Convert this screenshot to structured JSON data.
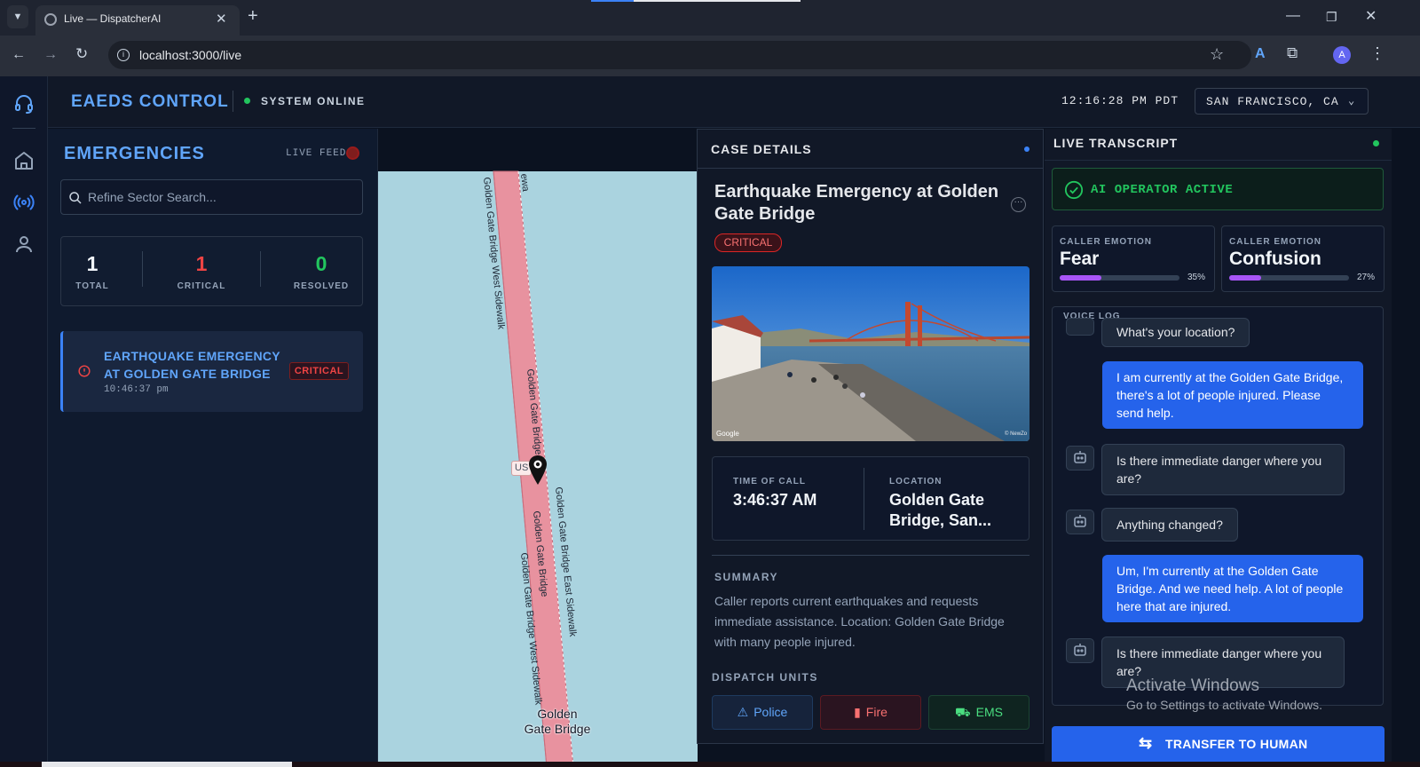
{
  "browser": {
    "tab_title": "Live — DispatcherAI",
    "url": "localhost:3000/live",
    "profile_initial": "A"
  },
  "header": {
    "brand": "EAEDS CONTROL",
    "status": "SYSTEM ONLINE",
    "clock": "12:16:28 PM PDT",
    "region": "SAN FRANCISCO, CA"
  },
  "emergencies": {
    "title": "EMERGENCIES",
    "live_feed": "LIVE FEED",
    "search_placeholder": "Refine Sector Search...",
    "stats": [
      {
        "value": "1",
        "label": "TOTAL",
        "color": "#f1f5f9"
      },
      {
        "value": "1",
        "label": "CRITICAL",
        "color": "#ef4444"
      },
      {
        "value": "0",
        "label": "RESOLVED",
        "color": "#22c55e"
      }
    ],
    "items": [
      {
        "title": "EARTHQUAKE EMERGENCY AT GOLDEN GATE BRIDGE",
        "time": "10:46:37 pm",
        "badge": "CRITICAL"
      }
    ]
  },
  "map": {
    "labels": {
      "west_sidewalk_top": "Golden Gate Bridge West Sidewalk",
      "bridge_main": "Golden Gate Bridge",
      "bridge_lower": "Golden Gate Bridge",
      "east_sidewalk": "Golden Gate Bridge East Sidewalk",
      "west_sidewalk_bottom": "Golden Gate Bridge West Sidewalk",
      "top_fragment": "ewa",
      "us_shield": "US",
      "place_line1": "Golden",
      "place_line2": "Gate Bridge"
    }
  },
  "case": {
    "header": "CASE DETAILS",
    "title": "Earthquake Emergency at Golden Gate Bridge",
    "severity": "CRITICAL",
    "time_label": "TIME OF CALL",
    "time_value": "3:46:37 AM",
    "location_label": "LOCATION",
    "location_value": "Golden Gate Bridge, San...",
    "summary_label": "SUMMARY",
    "summary": "Caller reports current earthquakes and requests immediate assistance. Location: Golden Gate Bridge with many people injured.",
    "dispatch_label": "DISPATCH UNITS",
    "units": [
      {
        "label": "Police",
        "color": "#60a5fa",
        "bg": "#16233b",
        "border": "#1e3a5f"
      },
      {
        "label": "Fire",
        "color": "#f87171",
        "bg": "#2a1420",
        "border": "#5b1a22"
      },
      {
        "label": "EMS",
        "color": "#4ade80",
        "bg": "#0f2420",
        "border": "#1b4332"
      }
    ],
    "photo_credit_left": "Google",
    "photo_credit_right": "© NewZo"
  },
  "transcript": {
    "title": "LIVE TRANSCRIPT",
    "ai_status": "AI OPERATOR ACTIVE",
    "emotions": [
      {
        "label": "CALLER EMOTION",
        "value": "Fear",
        "pct": "35%",
        "level": 0.35
      },
      {
        "label": "CALLER EMOTION",
        "value": "Confusion",
        "pct": "27%",
        "level": 0.27
      }
    ],
    "voice_log_label": "VOICE LOG",
    "messages": [
      {
        "role": "ai",
        "text": "What's your location?"
      },
      {
        "role": "user",
        "text": "I am currently at the Golden Gate Bridge, there's a lot of people injured. Please send help."
      },
      {
        "role": "ai",
        "text": "Is there immediate danger where you are?"
      },
      {
        "role": "ai",
        "text": "Anything changed?"
      },
      {
        "role": "user",
        "text": "Um, I'm currently at the Golden Gate Bridge. And we need help. A lot of people here that are injured."
      },
      {
        "role": "ai",
        "text": "Is there immediate danger where you are?"
      }
    ],
    "transfer_label": "TRANSFER TO HUMAN"
  },
  "os_overlay": {
    "line1": "Activate Windows",
    "line2": "Go to Settings to activate Windows."
  }
}
